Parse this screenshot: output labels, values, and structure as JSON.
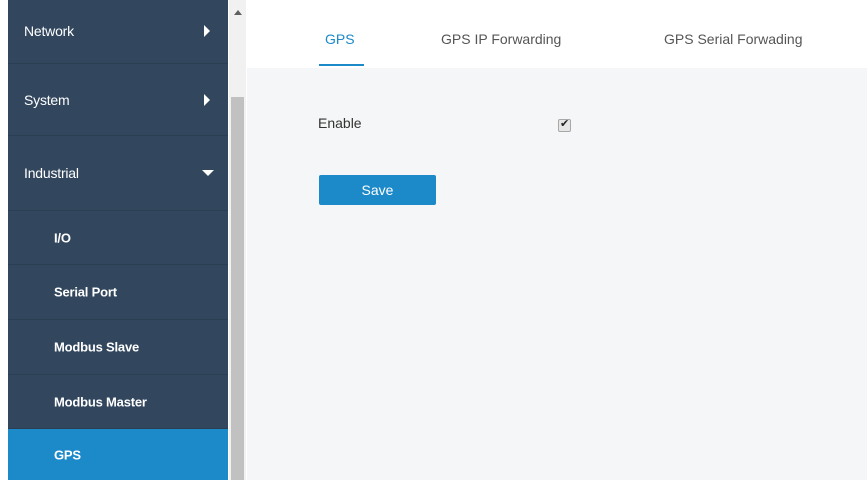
{
  "sidebar": {
    "items": [
      {
        "label": "Network"
      },
      {
        "label": "System"
      },
      {
        "label": "Industrial"
      },
      {
        "label": "I/O"
      },
      {
        "label": "Serial Port"
      },
      {
        "label": "Modbus Slave"
      },
      {
        "label": "Modbus Master"
      },
      {
        "label": "GPS"
      }
    ]
  },
  "tabs": [
    {
      "label": "GPS"
    },
    {
      "label": "GPS IP Forwarding"
    },
    {
      "label": "GPS Serial Forwading"
    }
  ],
  "form": {
    "enable_label": "Enable",
    "enable_checked": true,
    "check_glyph": "✔",
    "save_label": "Save"
  },
  "colors": {
    "sidebar_bg": "#32475e",
    "accent": "#1c89c9",
    "content_bg": "#f5f6f7"
  },
  "icons": {
    "network_caret": "caret-right-icon",
    "system_caret": "caret-right-icon",
    "industrial_caret": "caret-down-icon"
  }
}
